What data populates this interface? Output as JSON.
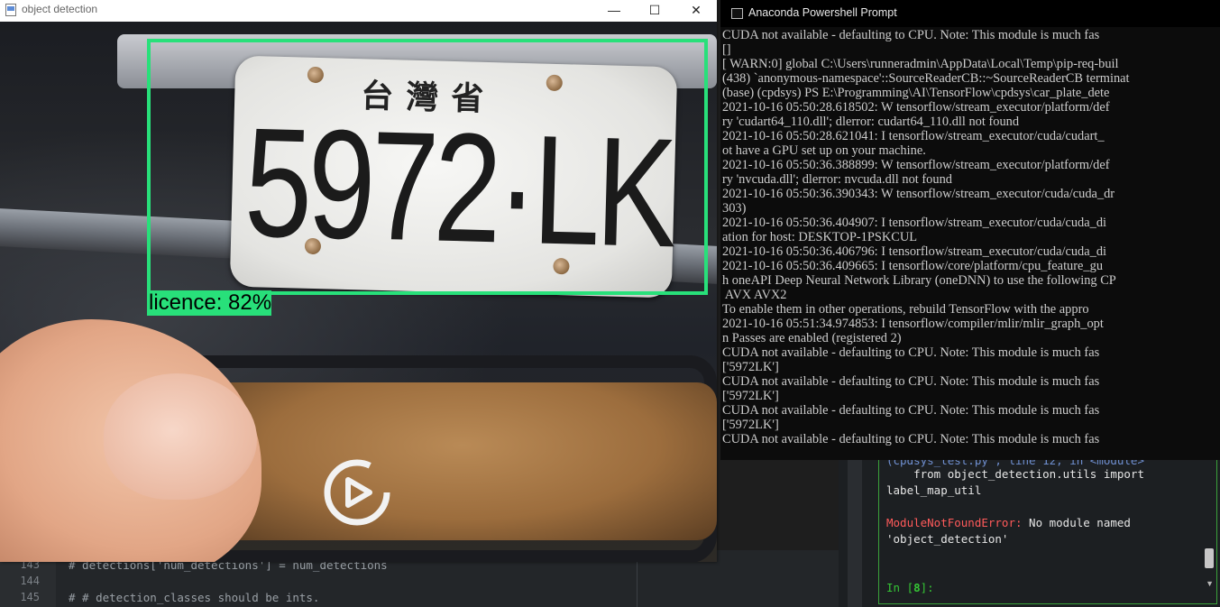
{
  "editor": {
    "lines": [
      {
        "num": "143",
        "code": "# detections['num_detections'] = num_detections"
      },
      {
        "num": "144",
        "code": ""
      },
      {
        "num": "145",
        "code": "# # detection_classes should be ints."
      }
    ]
  },
  "ipython": {
    "faded_line": "(cpdsys_test.py\", line 12, in <module>",
    "import_line_1": "    from object_detection.utils import",
    "import_line_2": "label_map_util",
    "error_name": "ModuleNotFoundError:",
    "error_msg": " No module named",
    "error_msg_2": "'object_detection'",
    "prompt_label": "In [",
    "prompt_number": "8",
    "prompt_end": "]:"
  },
  "object_detection_window": {
    "title": "object detection",
    "minimize": "—",
    "maximize": "☐",
    "close": "✕",
    "plate_header": "台灣省",
    "plate_number": "5972·LK",
    "detection_label": "licence: 82%",
    "box_color": "#28e07a"
  },
  "terminal": {
    "title": "Anaconda Powershell Prompt",
    "lines": [
      "CUDA not available - defaulting to CPU. Note: This module is much fas",
      "[]",
      "[ WARN:0] global C:\\Users\\runneradmin\\AppData\\Local\\Temp\\pip-req-buil",
      "(438) `anonymous-namespace'::SourceReaderCB::~SourceReaderCB terminat",
      "(base) (cpdsys) PS E:\\Programming\\AI\\TensorFlow\\cpdsys\\car_plate_dete",
      "2021-10-16 05:50:28.618502: W tensorflow/stream_executor/platform/def",
      "ry 'cudart64_110.dll'; dlerror: cudart64_110.dll not found",
      "2021-10-16 05:50:28.621041: I tensorflow/stream_executor/cuda/cudart_",
      "ot have a GPU set up on your machine.",
      "2021-10-16 05:50:36.388899: W tensorflow/stream_executor/platform/def",
      "ry 'nvcuda.dll'; dlerror: nvcuda.dll not found",
      "2021-10-16 05:50:36.390343: W tensorflow/stream_executor/cuda/cuda_dr",
      "303)",
      "2021-10-16 05:50:36.404907: I tensorflow/stream_executor/cuda/cuda_di",
      "ation for host: DESKTOP-1PSKCUL",
      "2021-10-16 05:50:36.406796: I tensorflow/stream_executor/cuda/cuda_di",
      "2021-10-16 05:50:36.409665: I tensorflow/core/platform/cpu_feature_gu",
      "h oneAPI Deep Neural Network Library (oneDNN) to use the following CP",
      " AVX AVX2",
      "To enable them in other operations, rebuild TensorFlow with the appro",
      "2021-10-16 05:51:34.974853: I tensorflow/compiler/mlir/mlir_graph_opt",
      "n Passes are enabled (registered 2)",
      "CUDA not available - defaulting to CPU. Note: This module is much fas",
      "['5972LK']",
      "CUDA not available - defaulting to CPU. Note: This module is much fas",
      "['5972LK']",
      "CUDA not available - defaulting to CPU. Note: This module is much fas",
      "['5972LK']",
      "CUDA not available - defaulting to CPU. Note: This module is much fas"
    ]
  }
}
